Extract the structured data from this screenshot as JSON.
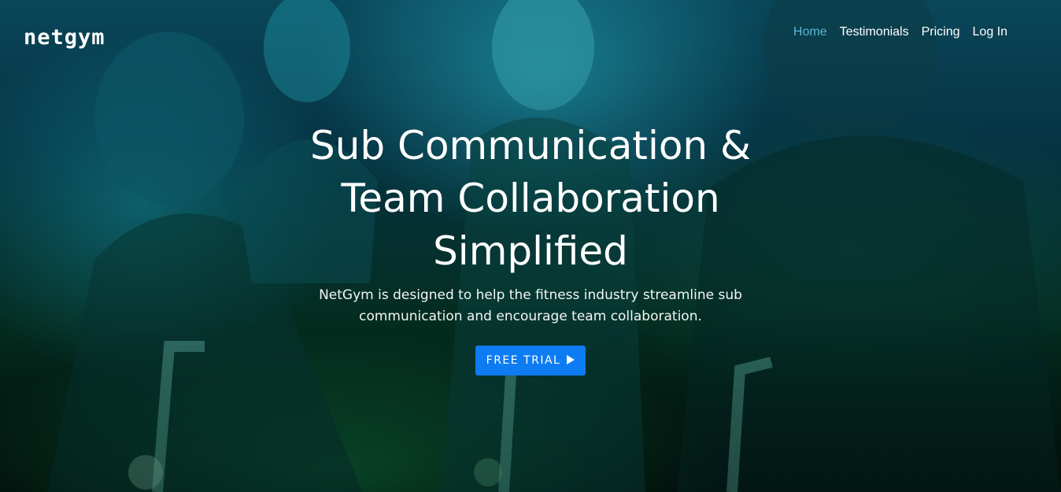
{
  "header": {
    "logo": "netgym",
    "nav": [
      {
        "label": "Home",
        "active": true
      },
      {
        "label": "Testimonials",
        "active": false
      },
      {
        "label": "Pricing",
        "active": false
      },
      {
        "label": "Log In",
        "active": false
      }
    ]
  },
  "hero": {
    "headline": "Sub Communication & Team Collaboration Simplified",
    "subtext": "NetGym is designed to help the fitness industry streamline sub communication and encourage team collaboration.",
    "cta_label": "FREE TRIAL",
    "cta_icon": "play-icon",
    "background": "photo of people on spin bikes with teal-to-green tint"
  },
  "colors": {
    "accent": "#0d7cf2",
    "nav_active": "#5bb6d8",
    "tint_top": "#0a4a5e",
    "tint_bottom": "#053526"
  }
}
